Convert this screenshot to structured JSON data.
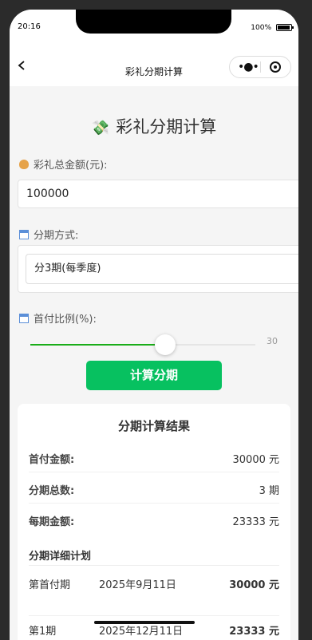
{
  "status": {
    "time": "20:16",
    "battery": "100%"
  },
  "nav": {
    "title": "彩礼分期计算"
  },
  "page": {
    "title": "彩礼分期计算",
    "title_icon": "money-icon"
  },
  "form": {
    "amount_label": "彩礼总金额(元):",
    "amount_value": "100000",
    "method_label": "分期方式:",
    "method_value": "分3期(每季度)",
    "ratio_label": "首付比例(%):",
    "ratio_value": "30",
    "ratio_fraction": 0.6,
    "calc_button": "计算分期"
  },
  "colors": {
    "accent": "#07c160",
    "slider": "#1aad19"
  },
  "result": {
    "title": "分期计算结果",
    "rows": [
      {
        "label": "首付金额:",
        "value": "30000 元"
      },
      {
        "label": "分期总数:",
        "value": "3 期"
      },
      {
        "label": "每期金额:",
        "value": "23333 元"
      }
    ],
    "detail_title": "分期详细计划",
    "plan": [
      {
        "period": "第首付期",
        "date": "2025年9月11日",
        "amount": "30000 元"
      },
      {
        "period": "第1期",
        "date": "2025年12月11日",
        "amount": "23333 元"
      }
    ]
  }
}
